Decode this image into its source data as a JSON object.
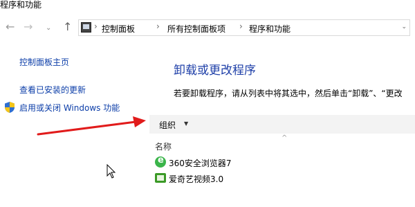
{
  "window": {
    "title": "程序和功能"
  },
  "nav": {
    "back_glyph": "←",
    "forward_glyph": "→",
    "dropdown_glyph": "⌄",
    "up_glyph": "↑"
  },
  "address": {
    "sep_glyph": "›",
    "crumbs": [
      "控制面板",
      "所有控制面板项",
      "程序和功能"
    ],
    "dropdown_glyph": "⌄"
  },
  "sidebar": {
    "home": "控制面板主页",
    "updates": "查看已安装的更新",
    "features": "启用或关闭 Windows 功能"
  },
  "main": {
    "title": "卸载或更改程序",
    "description": "若要卸载程序，请从列表中将其选中，然后单击“卸载”、“更改"
  },
  "toolbar": {
    "organize_label": "组织",
    "organize_caret": "▼"
  },
  "list": {
    "sort_glyph": "^",
    "column_name": "名称",
    "programs": [
      {
        "name": "360安全浏览器7",
        "icon": "360-browser-icon"
      },
      {
        "name": "爱奇艺视频3.0",
        "icon": "iqiyi-icon"
      }
    ]
  },
  "colors": {
    "link": "#0b3da8",
    "title": "#1e3fa8",
    "arrow": "#e11b1b",
    "toolbar_bg": "#f3f3f3"
  }
}
